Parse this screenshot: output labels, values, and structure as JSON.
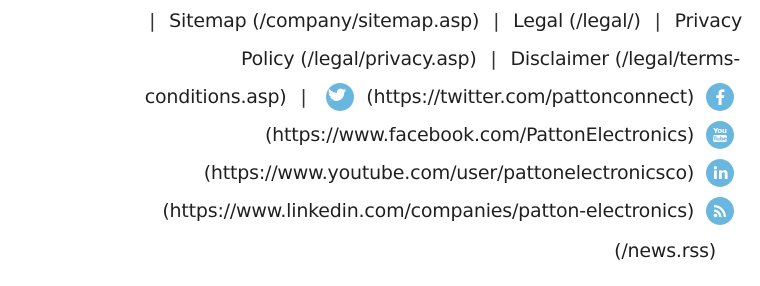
{
  "footer": {
    "sitemap": "Sitemap (/company/sitemap.asp)",
    "legal": "Legal (/legal/)",
    "privacy_part1": "Privacy",
    "privacy_part2": "Policy (/legal/privacy.asp)",
    "disclaimer_part1": "Disclaimer (/legal/terms-",
    "disclaimer_part2": "conditions.asp)",
    "twitter": "(https://twitter.com/pattonconnect)",
    "facebook": "(https://www.facebook.com/PattonElectronics)",
    "youtube": "(https://www.youtube.com/user/pattonelectronicsco)",
    "linkedin": "(https://www.linkedin.com/companies/patton-electronics)",
    "rss": "(/news.rss)",
    "separator": "|"
  },
  "icons": {
    "twitter": "twitter-icon",
    "facebook": "facebook-icon",
    "youtube": "youtube-icon",
    "linkedin": "linkedin-icon",
    "rss": "rss-icon",
    "color": "#69b6df"
  }
}
